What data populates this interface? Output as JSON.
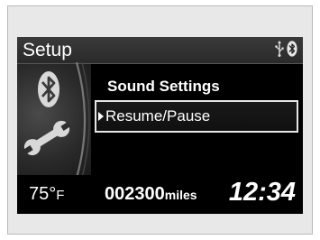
{
  "header": {
    "title": "Setup",
    "icons": [
      "usb-icon",
      "bluetooth-icon"
    ]
  },
  "menu": {
    "title": "Sound Settings",
    "selected_item": "Resume/Pause"
  },
  "left_panel": {
    "icons": [
      "bluetooth-icon",
      "wrench-icon"
    ]
  },
  "status": {
    "temperature_value": "75°",
    "temperature_unit": "F",
    "odometer_value": "002300",
    "odometer_unit": "miles",
    "clock": "12:34"
  },
  "colors": {
    "screen_background": "#000000",
    "header_background": "#2e2e2e",
    "text": "#ffffff",
    "selection_border": "#e6e6e6"
  }
}
